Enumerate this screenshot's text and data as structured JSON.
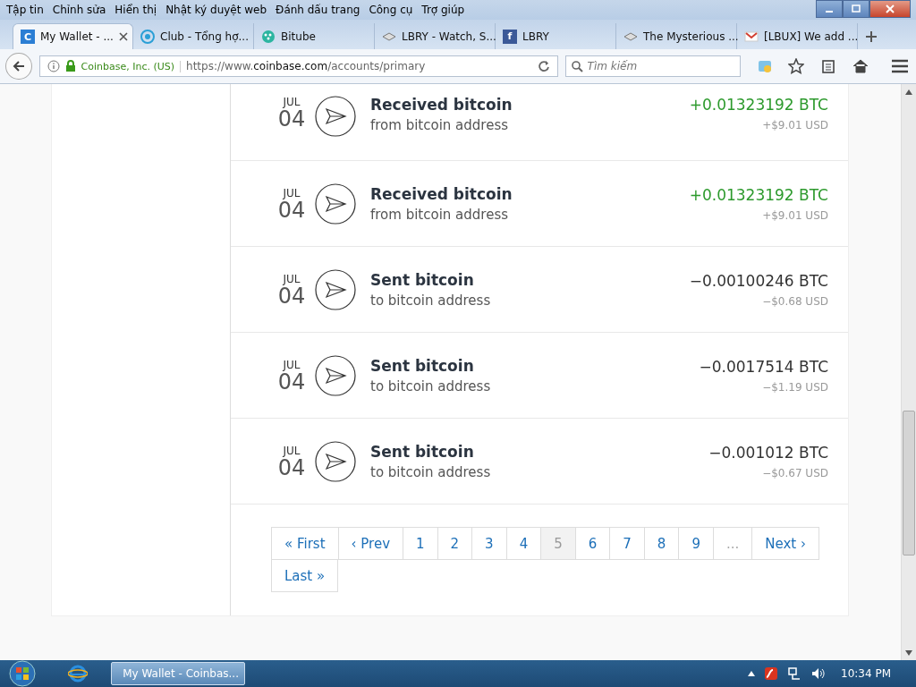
{
  "menu_bar": [
    "Tập tin",
    "Chỉnh sửa",
    "Hiển thị",
    "Nhật ký duyệt web",
    "Đánh dấu trang",
    "Công cụ",
    "Trợ giúp"
  ],
  "tabs": [
    {
      "title": "My Wallet - ...",
      "kind": "letter",
      "icon_text": "C",
      "selected": true
    },
    {
      "title": "Club - Tổng hợ...",
      "kind": "ring",
      "selected": false
    },
    {
      "title": "Bitube",
      "kind": "dots",
      "selected": false
    },
    {
      "title": "LBRY - Watch, S...",
      "kind": "cube",
      "selected": false
    },
    {
      "title": "LBRY",
      "kind": "square",
      "icon_text": "f",
      "selected": false
    },
    {
      "title": "The Mysterious ...",
      "kind": "cube",
      "selected": false
    },
    {
      "title": "[LBUX] We add ...",
      "kind": "mail",
      "selected": false
    }
  ],
  "nav": {
    "site_identity": "Coinbase, Inc. (US)",
    "url_prefix": "https://www.",
    "url_domain": "coinbase.com",
    "url_path": "/accounts/primary",
    "search": {
      "placeholder": "Tìm kiếm"
    }
  },
  "transactions": [
    {
      "month": "JUL",
      "day": "04",
      "kind": "received",
      "title": "Received bitcoin",
      "subtitle": "from bitcoin address",
      "amount": "+0.01323192 BTC",
      "fiat": "+$9.01 USD"
    },
    {
      "month": "JUL",
      "day": "04",
      "kind": "received",
      "title": "Received bitcoin",
      "subtitle": "from bitcoin address",
      "amount": "+0.01323192 BTC",
      "fiat": "+$9.01 USD"
    },
    {
      "month": "JUL",
      "day": "04",
      "kind": "sent",
      "title": "Sent bitcoin",
      "subtitle": "to bitcoin address",
      "amount": "−0.00100246 BTC",
      "fiat": "−$0.68 USD"
    },
    {
      "month": "JUL",
      "day": "04",
      "kind": "sent",
      "title": "Sent bitcoin",
      "subtitle": "to bitcoin address",
      "amount": "−0.0017514 BTC",
      "fiat": "−$1.19 USD"
    },
    {
      "month": "JUL",
      "day": "04",
      "kind": "sent",
      "title": "Sent bitcoin",
      "subtitle": "to bitcoin address",
      "amount": "−0.001012 BTC",
      "fiat": "−$0.67 USD"
    }
  ],
  "pagination": [
    {
      "label": "« First",
      "selected": false,
      "disabled": false
    },
    {
      "label": "‹ Prev",
      "selected": false,
      "disabled": false
    },
    {
      "label": "1",
      "selected": false,
      "disabled": false
    },
    {
      "label": "2",
      "selected": false,
      "disabled": false
    },
    {
      "label": "3",
      "selected": false,
      "disabled": false
    },
    {
      "label": "4",
      "selected": false,
      "disabled": false
    },
    {
      "label": "5",
      "selected": true,
      "disabled": false
    },
    {
      "label": "6",
      "selected": false,
      "disabled": false
    },
    {
      "label": "7",
      "selected": false,
      "disabled": false
    },
    {
      "label": "8",
      "selected": false,
      "disabled": false
    },
    {
      "label": "9",
      "selected": false,
      "disabled": false
    },
    {
      "label": "...",
      "selected": false,
      "disabled": true
    },
    {
      "label": "Next ›",
      "selected": false,
      "disabled": false
    },
    {
      "label": "Last »",
      "selected": false,
      "disabled": false
    }
  ],
  "taskbar": {
    "window_title": "My Wallet - Coinbas...",
    "clock": "10:34 PM"
  }
}
